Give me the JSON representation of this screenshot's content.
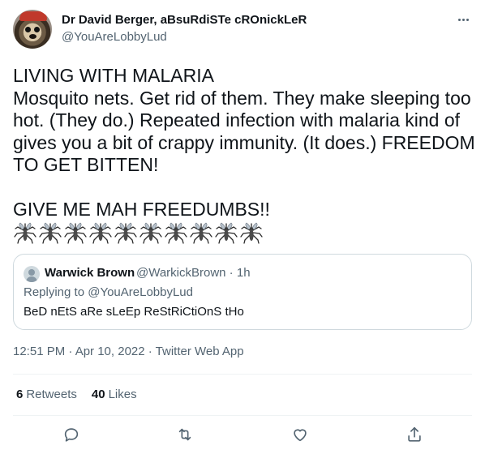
{
  "tweet": {
    "author_name": "Dr David Berger, aBsuRdiSTe cROnickLeR",
    "author_handle": "@YouAreLobbyLud",
    "text_lines": [
      "LIVING WITH MALARIA",
      "Mosquito nets. Get rid of them. They make sleeping too",
      "hot. (They do.) Repeated infection with malaria kind of",
      "gives you a bit of crappy immunity. (It does.) FREEDOM",
      "TO GET BITTEN!",
      "",
      "GIVE ME MAH FREEDUMBS!!"
    ],
    "emoji_count": 10,
    "emoji_icon": "mosquito-icon",
    "timestamp": "12:51 PM · Apr 10, 2022 · Twitter Web App"
  },
  "quote": {
    "name": "Warwick Brown",
    "handle_time": "@WarkickBrown · 1h",
    "reply_prefix": "Replying to ",
    "reply_handle": "@YouAreLobbyLud",
    "text": "BeD nEtS aRe sLeEp ReStRiCtiOnS tHo"
  },
  "stats": {
    "retweets_count": "6",
    "retweets_label": "Retweets",
    "likes_count": "40",
    "likes_label": "Likes"
  },
  "icons": {
    "more": "more-icon",
    "reply": "reply-icon",
    "retweet": "retweet-icon",
    "like": "heart-icon",
    "share": "share-icon"
  },
  "colors": {
    "text": "#0f1419",
    "secondary": "#536471",
    "border": "#cfd9de"
  }
}
